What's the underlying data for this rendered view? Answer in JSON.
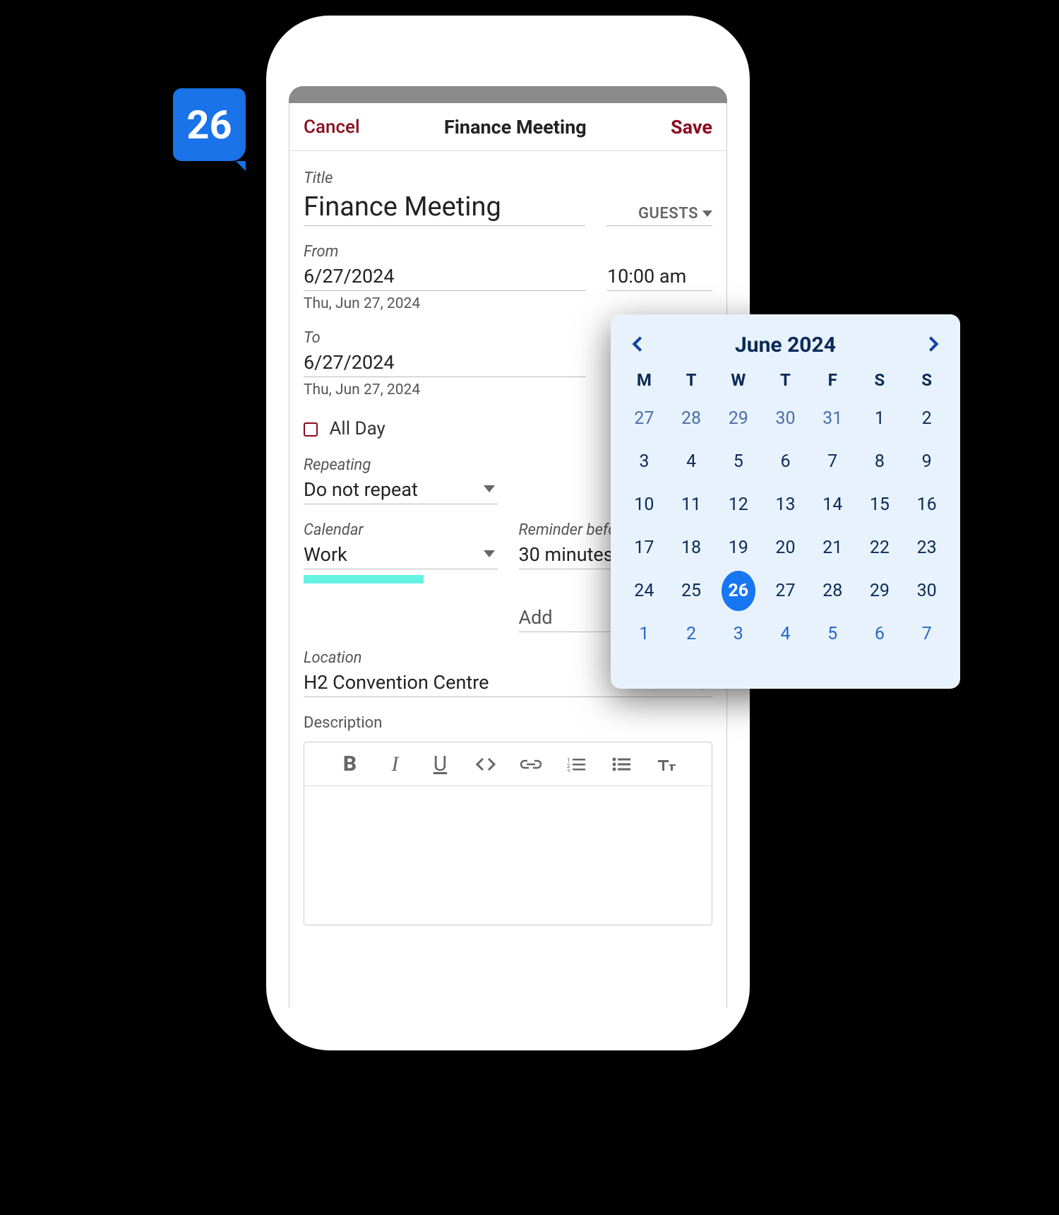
{
  "badge": {
    "day": "26"
  },
  "header": {
    "cancel": "Cancel",
    "title": "Finance Meeting",
    "save": "Save"
  },
  "form": {
    "title_label": "Title",
    "title_value": "Finance Meeting",
    "guests_label": "GUESTS",
    "from_label": "From",
    "from_date": "6/27/2024",
    "from_time": "10:00 am",
    "from_sub": "Thu, Jun 27, 2024",
    "to_label": "To",
    "to_date": "6/27/2024",
    "to_sub": "Thu, Jun 27, 2024",
    "allday_label": "All Day",
    "repeating_label": "Repeating",
    "repeating_value": "Do not repeat",
    "calendar_label": "Calendar",
    "calendar_value": "Work",
    "reminder_label": "Reminder before",
    "reminder_value": "30 minutes",
    "add_placeholder": "Add",
    "location_label": "Location",
    "location_value": "H2 Convention Centre",
    "description_label": "Description"
  },
  "datepicker": {
    "month_title": "June 2024",
    "weekdays": [
      "M",
      "T",
      "W",
      "T",
      "F",
      "S",
      "S"
    ],
    "weeks": [
      [
        {
          "n": "27",
          "t": "muted"
        },
        {
          "n": "28",
          "t": "muted"
        },
        {
          "n": "29",
          "t": "muted"
        },
        {
          "n": "30",
          "t": "muted"
        },
        {
          "n": "31",
          "t": "muted"
        },
        {
          "n": "1",
          "t": ""
        },
        {
          "n": "2",
          "t": ""
        }
      ],
      [
        {
          "n": "3",
          "t": ""
        },
        {
          "n": "4",
          "t": ""
        },
        {
          "n": "5",
          "t": ""
        },
        {
          "n": "6",
          "t": ""
        },
        {
          "n": "7",
          "t": ""
        },
        {
          "n": "8",
          "t": ""
        },
        {
          "n": "9",
          "t": ""
        }
      ],
      [
        {
          "n": "10",
          "t": ""
        },
        {
          "n": "11",
          "t": ""
        },
        {
          "n": "12",
          "t": ""
        },
        {
          "n": "13",
          "t": ""
        },
        {
          "n": "14",
          "t": ""
        },
        {
          "n": "15",
          "t": ""
        },
        {
          "n": "16",
          "t": ""
        }
      ],
      [
        {
          "n": "17",
          "t": ""
        },
        {
          "n": "18",
          "t": ""
        },
        {
          "n": "19",
          "t": ""
        },
        {
          "n": "20",
          "t": ""
        },
        {
          "n": "21",
          "t": ""
        },
        {
          "n": "22",
          "t": ""
        },
        {
          "n": "23",
          "t": ""
        }
      ],
      [
        {
          "n": "24",
          "t": ""
        },
        {
          "n": "25",
          "t": ""
        },
        {
          "n": "26",
          "t": "selected"
        },
        {
          "n": "27",
          "t": ""
        },
        {
          "n": "28",
          "t": ""
        },
        {
          "n": "29",
          "t": ""
        },
        {
          "n": "30",
          "t": ""
        }
      ],
      [
        {
          "n": "1",
          "t": "next"
        },
        {
          "n": "2",
          "t": "next"
        },
        {
          "n": "3",
          "t": "next"
        },
        {
          "n": "4",
          "t": "next"
        },
        {
          "n": "5",
          "t": "next"
        },
        {
          "n": "6",
          "t": "next"
        },
        {
          "n": "7",
          "t": "next"
        }
      ]
    ]
  }
}
